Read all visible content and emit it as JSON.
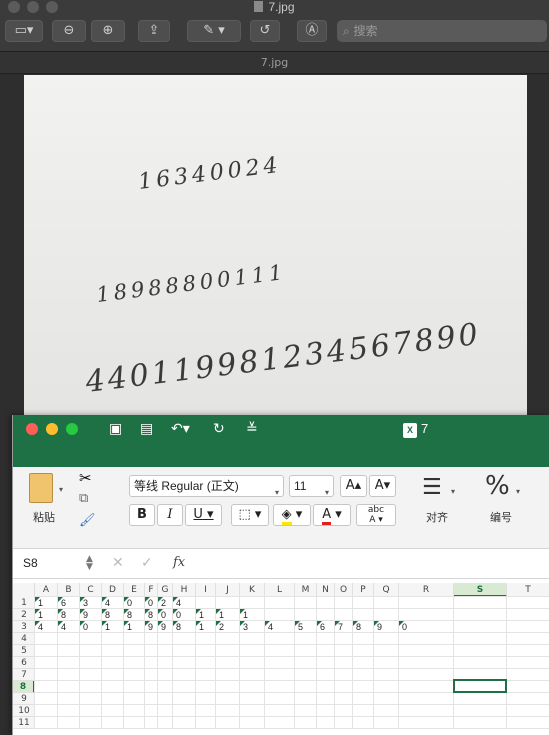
{
  "preview": {
    "title": "7.jpg",
    "tab_label": "7.jpg",
    "search_placeholder": "搜索",
    "handwriting": {
      "line1": "16340024",
      "line2": "18988800111",
      "line3": "440119981234567890"
    }
  },
  "excel": {
    "title": "7",
    "font_name": "等线 Regular (正文)",
    "font_size": "11",
    "paste_label": "粘贴",
    "align_label": "对齐",
    "number_label": "编号",
    "bold": "B",
    "italic": "I",
    "underline": "U",
    "percent": "%",
    "name_box": "S8",
    "fx": "fx",
    "columns": [
      "A",
      "B",
      "C",
      "D",
      "E",
      "F",
      "G",
      "H",
      "I",
      "J",
      "K",
      "L",
      "M",
      "N",
      "O",
      "P",
      "Q",
      "R",
      "S",
      "T"
    ],
    "rows": [
      "1",
      "2",
      "3",
      "4",
      "5",
      "6",
      "7",
      "8",
      "9",
      "10",
      "11"
    ],
    "row1": [
      "1",
      "6",
      "3",
      "4",
      "0",
      "0",
      "2",
      "4"
    ],
    "row2": [
      "1",
      "8",
      "9",
      "8",
      "8",
      "8",
      "0",
      "0",
      "1",
      "1",
      "1"
    ],
    "row3": [
      "4",
      "4",
      "0",
      "1",
      "1",
      "9",
      "9",
      "8",
      "1",
      "2",
      "3",
      "4",
      "5",
      "6",
      "7",
      "8",
      "9",
      "0"
    ],
    "active_cell": "S8"
  },
  "colors": {
    "excel_green": "#1e7145",
    "font_color_red": "#e02020",
    "highlight_yellow": "#ffe600"
  }
}
